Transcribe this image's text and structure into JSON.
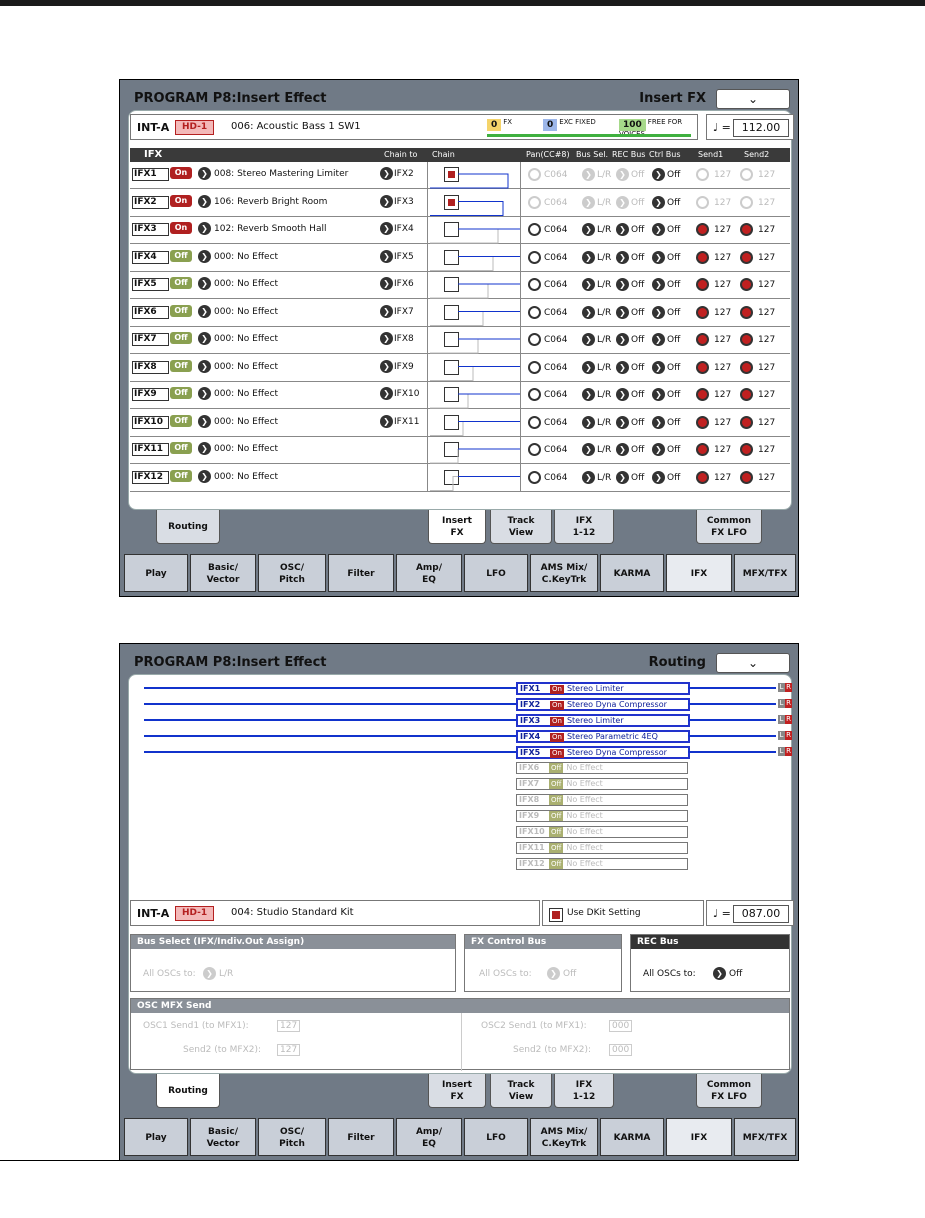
{
  "screen1": {
    "title": "PROGRAM P8:Insert Effect",
    "page": "Insert FX",
    "bank": "INT-A",
    "hd": "HD-1",
    "program": "006: Acoustic Bass 1 SW1",
    "tempo": "112.00",
    "counts": {
      "fx": "0",
      "fx_label": "FX",
      "exc": "0",
      "exc_label": "EXC FIXED",
      "free": "100",
      "free_label": "FREE FOR VOICES"
    },
    "headers": {
      "ifx": "IFX",
      "chain_to": "Chain to",
      "chain": "Chain",
      "pan": "Pan(CC#8)",
      "bus": "Bus Sel.",
      "rec": "REC Bus",
      "ctrl": "Ctrl Bus",
      "send1": "Send1",
      "send2": "Send2"
    },
    "rows": [
      {
        "ifx": "IFX1",
        "state": "On",
        "effect": "008: Stereo Mastering Limiter",
        "chain_to": "IFX2",
        "pan": "C064",
        "bus": "L/R",
        "rec": "Off",
        "ctrl": "Off",
        "send1": "127",
        "send2": "127"
      },
      {
        "ifx": "IFX2",
        "state": "On",
        "effect": "106: Reverb Bright Room",
        "chain_to": "IFX3",
        "pan": "C064",
        "bus": "L/R",
        "rec": "Off",
        "ctrl": "Off",
        "send1": "127",
        "send2": "127"
      },
      {
        "ifx": "IFX3",
        "state": "On",
        "effect": "102: Reverb Smooth Hall",
        "chain_to": "IFX4",
        "pan": "C064",
        "bus": "L/R",
        "rec": "Off",
        "ctrl": "Off",
        "send1": "127",
        "send2": "127"
      },
      {
        "ifx": "IFX4",
        "state": "Off",
        "effect": "000: No Effect",
        "chain_to": "IFX5",
        "pan": "C064",
        "bus": "L/R",
        "rec": "Off",
        "ctrl": "Off",
        "send1": "127",
        "send2": "127"
      },
      {
        "ifx": "IFX5",
        "state": "Off",
        "effect": "000: No Effect",
        "chain_to": "IFX6",
        "pan": "C064",
        "bus": "L/R",
        "rec": "Off",
        "ctrl": "Off",
        "send1": "127",
        "send2": "127"
      },
      {
        "ifx": "IFX6",
        "state": "Off",
        "effect": "000: No Effect",
        "chain_to": "IFX7",
        "pan": "C064",
        "bus": "L/R",
        "rec": "Off",
        "ctrl": "Off",
        "send1": "127",
        "send2": "127"
      },
      {
        "ifx": "IFX7",
        "state": "Off",
        "effect": "000: No Effect",
        "chain_to": "IFX8",
        "pan": "C064",
        "bus": "L/R",
        "rec": "Off",
        "ctrl": "Off",
        "send1": "127",
        "send2": "127"
      },
      {
        "ifx": "IFX8",
        "state": "Off",
        "effect": "000: No Effect",
        "chain_to": "IFX9",
        "pan": "C064",
        "bus": "L/R",
        "rec": "Off",
        "ctrl": "Off",
        "send1": "127",
        "send2": "127"
      },
      {
        "ifx": "IFX9",
        "state": "Off",
        "effect": "000: No Effect",
        "chain_to": "IFX10",
        "pan": "C064",
        "bus": "L/R",
        "rec": "Off",
        "ctrl": "Off",
        "send1": "127",
        "send2": "127"
      },
      {
        "ifx": "IFX10",
        "state": "Off",
        "effect": "000: No Effect",
        "chain_to": "IFX11",
        "pan": "C064",
        "bus": "L/R",
        "rec": "Off",
        "ctrl": "Off",
        "send1": "127",
        "send2": "127"
      },
      {
        "ifx": "IFX11",
        "state": "Off",
        "effect": "000: No Effect",
        "chain_to": "",
        "pan": "C064",
        "bus": "L/R",
        "rec": "Off",
        "ctrl": "Off",
        "send1": "127",
        "send2": "127"
      },
      {
        "ifx": "IFX12",
        "state": "Off",
        "effect": "000: No Effect",
        "chain_to": "",
        "pan": "C064",
        "bus": "L/R",
        "rec": "Off",
        "ctrl": "Off",
        "send1": "127",
        "send2": "127"
      }
    ]
  },
  "screen2": {
    "title": "PROGRAM P8:Insert Effect",
    "page": "Routing",
    "bank": "INT-A",
    "hd": "HD-1",
    "program": "004: Studio Standard Kit",
    "use_dkit": "Use DKit Setting",
    "tempo": "087.00",
    "fx": [
      {
        "ifx": "IFX1",
        "state": "On",
        "effect": "Stereo Limiter"
      },
      {
        "ifx": "IFX2",
        "state": "On",
        "effect": "Stereo Dyna Compressor"
      },
      {
        "ifx": "IFX3",
        "state": "On",
        "effect": "Stereo Limiter"
      },
      {
        "ifx": "IFX4",
        "state": "On",
        "effect": "Stereo Parametric 4EQ"
      },
      {
        "ifx": "IFX5",
        "state": "On",
        "effect": "Stereo Dyna Compressor"
      },
      {
        "ifx": "IFX6",
        "state": "Off",
        "effect": "No Effect"
      },
      {
        "ifx": "IFX7",
        "state": "Off",
        "effect": "No Effect"
      },
      {
        "ifx": "IFX8",
        "state": "Off",
        "effect": "No Effect"
      },
      {
        "ifx": "IFX9",
        "state": "Off",
        "effect": "No Effect"
      },
      {
        "ifx": "IFX10",
        "state": "Off",
        "effect": "No Effect"
      },
      {
        "ifx": "IFX11",
        "state": "Off",
        "effect": "No Effect"
      },
      {
        "ifx": "IFX12",
        "state": "Off",
        "effect": "No Effect"
      }
    ],
    "lr": {
      "l": "L",
      "r": "R"
    },
    "bus_select": {
      "title": "Bus Select (IFX/Indiv.Out Assign)",
      "label": "All OSCs to:",
      "value": "L/R"
    },
    "fx_control": {
      "title": "FX Control Bus",
      "label": "All OSCs to:",
      "value": "Off"
    },
    "rec_bus": {
      "title": "REC Bus",
      "label": "All OSCs to:",
      "value": "Off"
    },
    "osc_mfx": {
      "title": "OSC MFX Send",
      "osc1_send1_label": "OSC1 Send1 (to MFX1):",
      "osc1_send1": "127",
      "osc1_send2_label": "Send2 (to MFX2):",
      "osc1_send2": "127",
      "osc2_send1_label": "OSC2 Send1 (to MFX1):",
      "osc2_send1": "000",
      "osc2_send2_label": "Send2 (to MFX2):",
      "osc2_send2": "000"
    }
  },
  "subtabs": [
    {
      "line1": "Routing",
      "line2": ""
    },
    {
      "line1": "Insert",
      "line2": "FX"
    },
    {
      "line1": "Track",
      "line2": "View"
    },
    {
      "line1": "IFX",
      "line2": "1-12"
    },
    {
      "line1": "Common",
      "line2": "FX LFO"
    }
  ],
  "maintabs": [
    {
      "line1": "Play",
      "line2": ""
    },
    {
      "line1": "Basic/",
      "line2": "Vector"
    },
    {
      "line1": "OSC/",
      "line2": "Pitch"
    },
    {
      "line1": "Filter",
      "line2": ""
    },
    {
      "line1": "Amp/",
      "line2": "EQ"
    },
    {
      "line1": "LFO",
      "line2": ""
    },
    {
      "line1": "AMS Mix/",
      "line2": "C.KeyTrk"
    },
    {
      "line1": "KARMA",
      "line2": ""
    },
    {
      "line1": "IFX",
      "line2": ""
    },
    {
      "line1": "MFX/TFX",
      "line2": ""
    }
  ],
  "dropdown_icon": "chevron-down-icon"
}
